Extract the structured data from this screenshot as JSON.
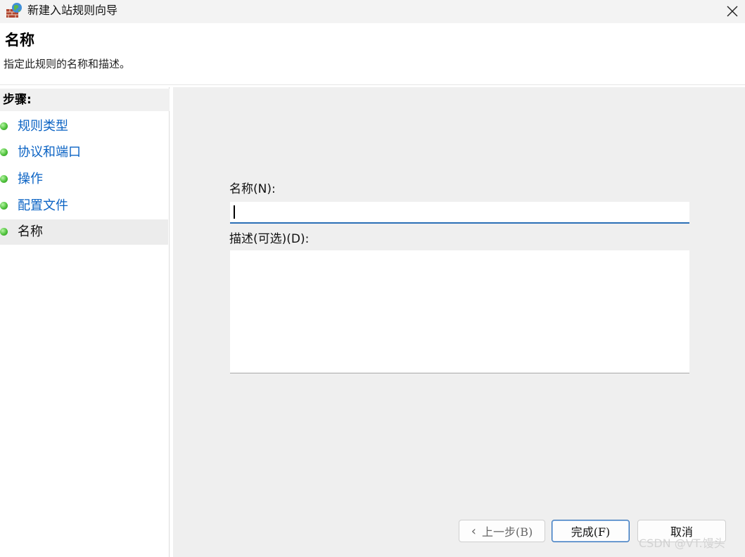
{
  "window": {
    "title": "新建入站规则向导",
    "icon": "firewall-globe-icon"
  },
  "header": {
    "title": "名称",
    "description": "指定此规则的名称和描述。"
  },
  "steps": {
    "heading": "步骤:",
    "items": [
      {
        "label": "规则类型",
        "state": "link"
      },
      {
        "label": "协议和端口",
        "state": "link"
      },
      {
        "label": "操作",
        "state": "link"
      },
      {
        "label": "配置文件",
        "state": "link"
      },
      {
        "label": "名称",
        "state": "current"
      }
    ]
  },
  "form": {
    "name_label": "名称(N):",
    "name_value": "",
    "description_label": "描述(可选)(D):",
    "description_value": ""
  },
  "buttons": {
    "back": "上一步(B)",
    "finish": "完成(F)",
    "cancel": "取消"
  },
  "watermark": "CSDN @VT.馒头",
  "colors": {
    "link": "#0b63c4",
    "step_dot": "#4fc23c",
    "focus_border": "#2a6fb6",
    "content_bg": "#efefef"
  }
}
